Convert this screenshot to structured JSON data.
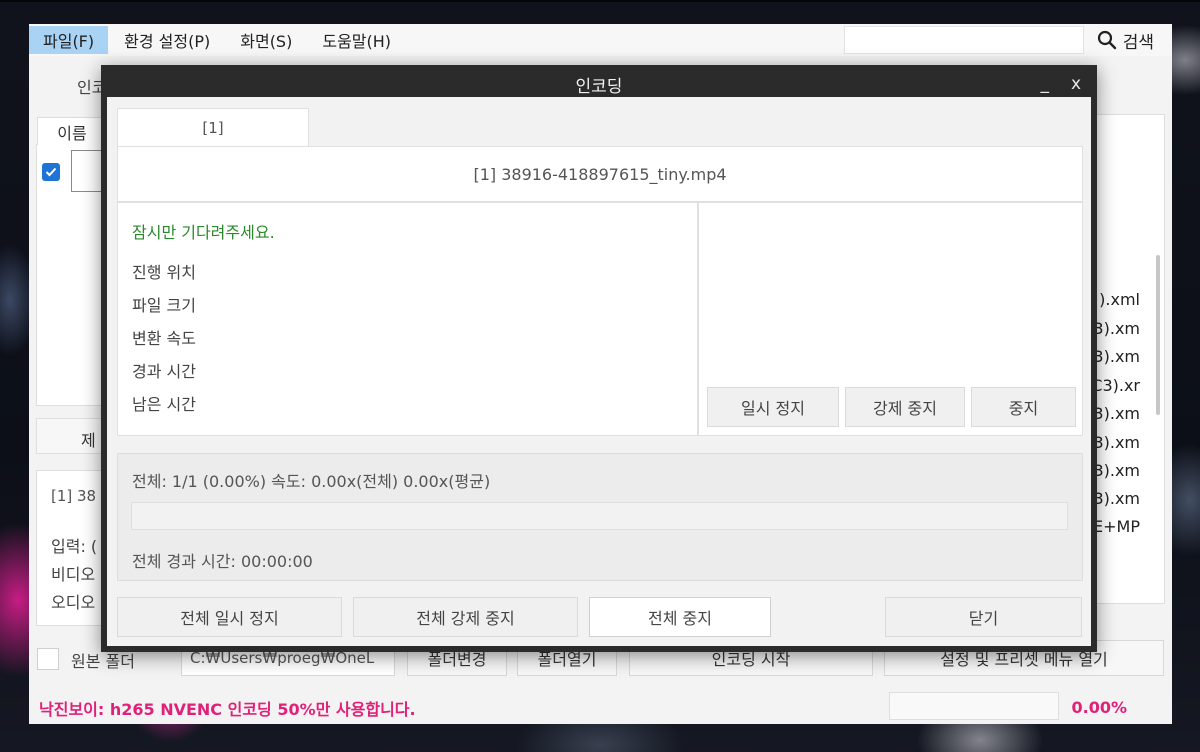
{
  "menu": {
    "items": [
      "파일(F)",
      "환경 설정(P)",
      "화면(S)",
      "도움말(H)"
    ],
    "active_index": 0
  },
  "search": {
    "placeholder": "",
    "button_label": "검색"
  },
  "background_app": {
    "partial_labels": {
      "encoding_label": "인코",
      "column_name": "이름",
      "partial_button": "제",
      "partial_file": "[1] 38",
      "input_label": "입력: (",
      "video_label": "비디오",
      "audio_label": "오디오"
    },
    "right_list": [
      ").xml",
      "P3).xm",
      "P3).xm",
      "C3).xr",
      "P3).xm",
      "3).xm",
      "3).xm",
      "3).xm",
      "E+MP"
    ],
    "bottom_controls": {
      "source_folder_label": "원본 폴더",
      "folder_path": "C:₩Users₩proeg₩OneL",
      "change_folder": "폴더변경",
      "open_folder": "폴더열기",
      "start_encoding": "인코딩 시작",
      "open_presets": "설정 및 프리셋 메뉴 열기"
    },
    "status": {
      "message": "낙진보이: h265 NVENC 인코딩 50%만 사용합니다.",
      "percent": "0.00%"
    },
    "accent_color": "#e0217a"
  },
  "dialog": {
    "title": "인코딩",
    "minimize": "_",
    "close": "x",
    "tab_label": "[1]",
    "file_header": "[1] 38916-418897615_tiny.mp4",
    "wait_message": "잠시만 기다려주세요.",
    "info_labels": [
      "진행 위치",
      "파일 크기",
      "변환 속도",
      "경과 시간",
      "남은 시간"
    ],
    "actions": {
      "pause": "일시 정지",
      "force_stop": "강제 중지",
      "stop": "중지"
    },
    "overall": {
      "summary": "전체: 1/1 (0.00%) 속도: 0.00x(전체) 0.00x(평균)",
      "progress": 0,
      "elapsed": "전체 경과 시간: 00:00:00"
    },
    "footer": {
      "pause_all": "전체 일시 정지",
      "force_stop_all": "전체 강제 중지",
      "stop_all": "전체 중지",
      "close": "닫기"
    }
  }
}
